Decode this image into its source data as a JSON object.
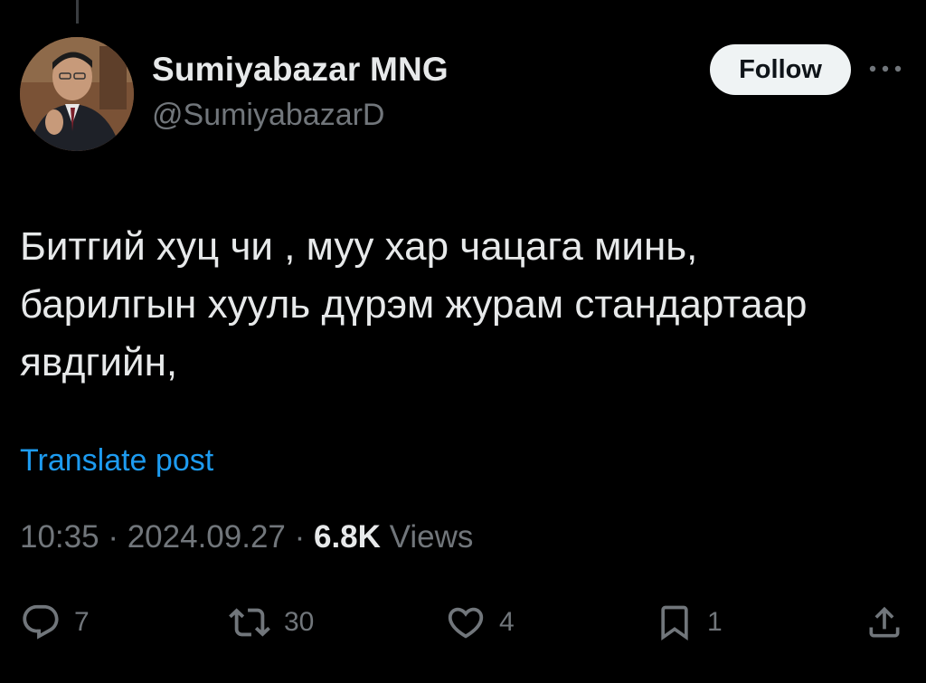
{
  "author": {
    "name": "Sumiyabazar MNG",
    "handle": "@SumiyabazarD"
  },
  "header": {
    "follow_label": "Follow",
    "more_icon": "more-horizontal-icon"
  },
  "post": {
    "lines": [
      "Битгий хуц чи , муу хар чацага минь,",
      "барилгын хууль дүрэм журам стандартаар",
      "явдгийн,"
    ],
    "translate_label": "Translate post"
  },
  "meta": {
    "time": "10:35",
    "sep1": " · ",
    "date": "2024.09.27",
    "sep2": " · ",
    "views_count": "6.8K",
    "views_label": " Views"
  },
  "actions": {
    "replies": {
      "icon": "reply-icon",
      "count": "7"
    },
    "reposts": {
      "icon": "repost-icon",
      "count": "30"
    },
    "likes": {
      "icon": "heart-icon",
      "count": "4"
    },
    "bookmarks": {
      "icon": "bookmark-icon",
      "count": "1"
    },
    "share": {
      "icon": "share-icon"
    }
  },
  "colors": {
    "background": "#000000",
    "primary_text": "#e7e9ea",
    "secondary_text": "#71767b",
    "accent_link": "#1d9bf0",
    "follow_button_bg": "#eff3f4"
  }
}
